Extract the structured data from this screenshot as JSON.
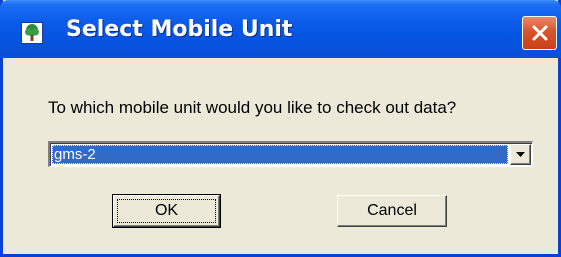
{
  "window": {
    "title": "Select Mobile Unit",
    "app_icon": "tree-icon",
    "close_icon": "close-icon"
  },
  "dialog": {
    "prompt": "To which mobile unit would you like to check out data?",
    "mobile_unit_select": {
      "selected_value": "gms-2",
      "arrow_icon": "dropdown-arrow-icon"
    },
    "ok_label": "OK",
    "cancel_label": "Cancel"
  },
  "colors": {
    "titlebar": "#0553e0",
    "close_button": "#d9532c",
    "dialog_background": "#ece9d8",
    "selection_highlight": "#316ac5"
  }
}
